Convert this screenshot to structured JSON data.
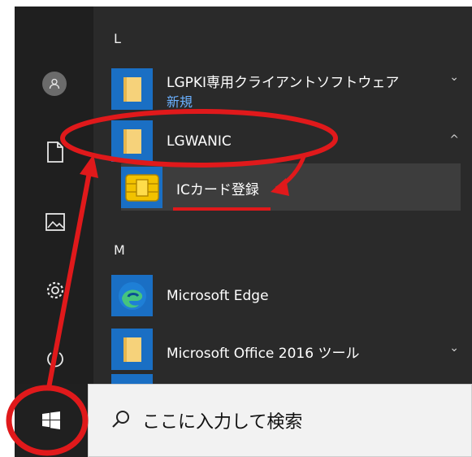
{
  "colors": {
    "background": "#1f1f1f",
    "list_background": "#2a2a2a",
    "tile_blue": "#1a6fc4",
    "folder_yellow": "#f6d27a",
    "accent_text": "#6ab0ff",
    "annotation_red": "#e0191b",
    "taskbar": "#202020",
    "search_bg": "#f2f2f2"
  },
  "start_menu": {
    "section_l": "L",
    "section_m": "M",
    "apps": [
      {
        "label": "LGPKI専用クライアントソフトウェア",
        "sublabel": "新規",
        "icon": "folder-icon",
        "chevron": "⌄"
      },
      {
        "label": "LGWANIC",
        "icon": "folder-icon",
        "chevron": "^"
      },
      {
        "label": "ICカード登録",
        "icon": "smartcard-chip-icon"
      },
      {
        "label": "Microsoft Edge",
        "icon": "edge-icon"
      },
      {
        "label": "Microsoft Office 2016 ツール",
        "icon": "folder-icon",
        "chevron": "⌄"
      }
    ]
  },
  "rail_icons": [
    "user-icon",
    "document-icon",
    "pictures-icon",
    "settings-icon",
    "power-icon"
  ],
  "taskbar": {
    "start_icon": "windows-start-icon",
    "search_icon": "search-icon",
    "search_placeholder": "ここに入力して検索"
  }
}
